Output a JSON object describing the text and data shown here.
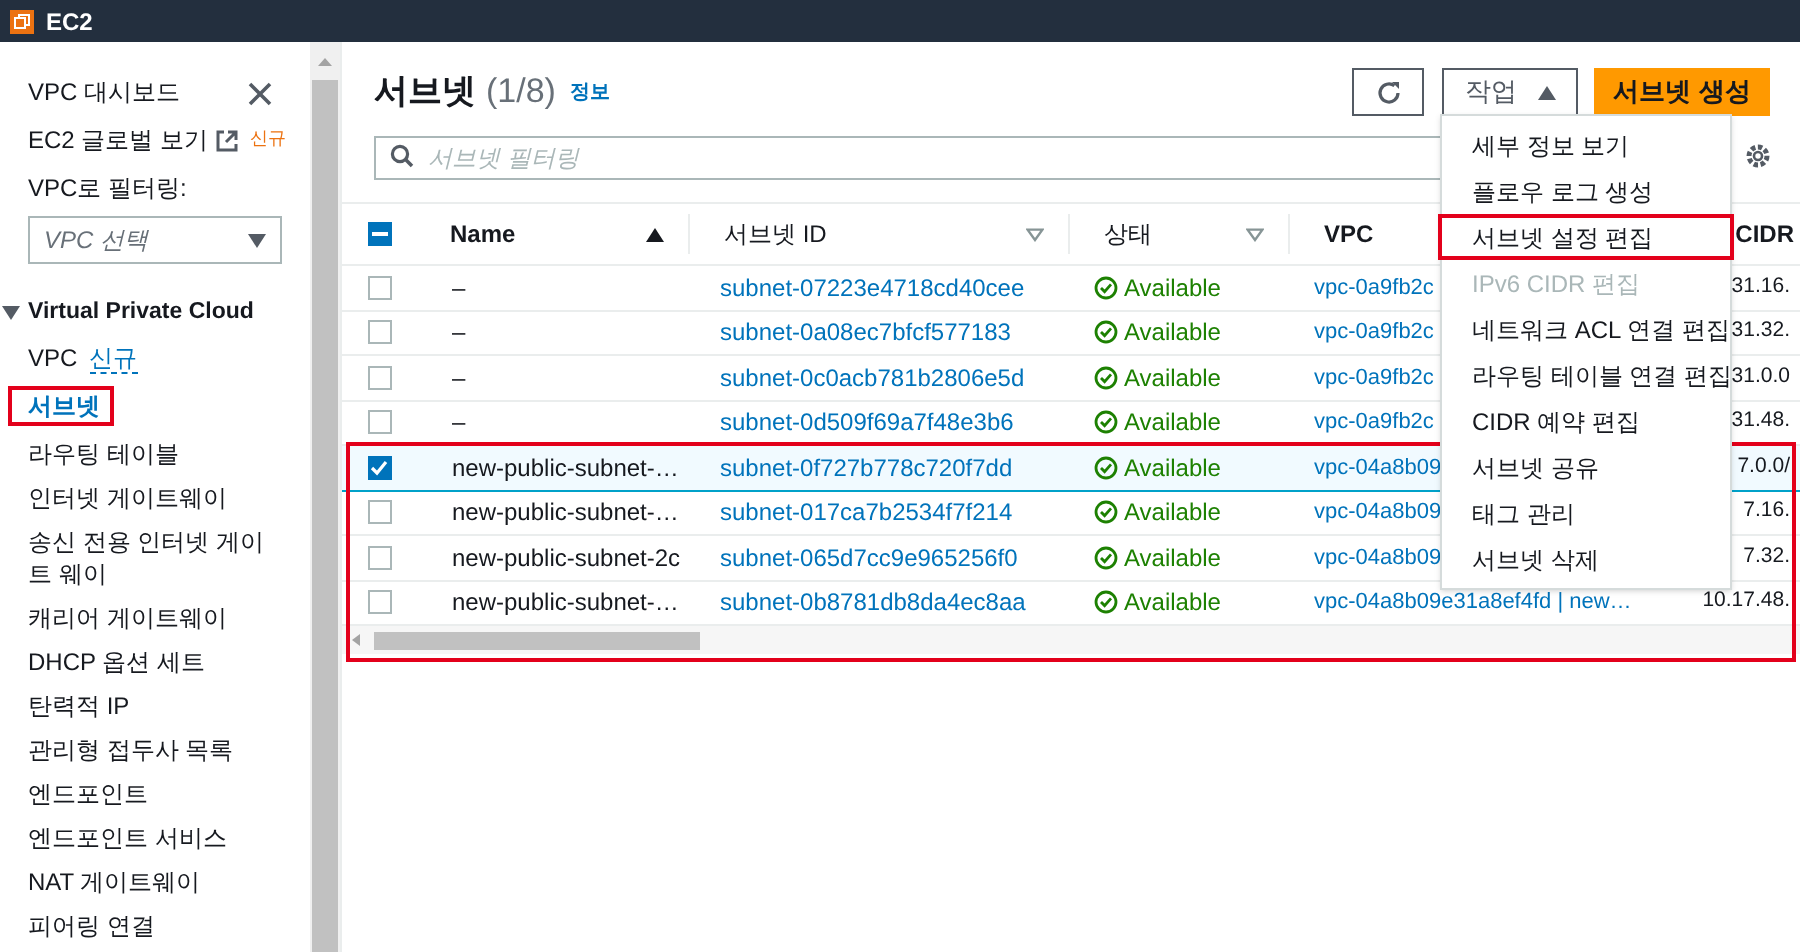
{
  "top_bar": {
    "title": "EC2"
  },
  "sidebar": {
    "links": [
      {
        "label": "VPC 대시보드"
      },
      {
        "label": "EC2 글로벌 보기",
        "badge": "신규"
      }
    ],
    "filter_label": "VPC로 필터링:",
    "vpc_select": {
      "placeholder": "VPC 선택"
    },
    "section": {
      "title": "Virtual Private Cloud",
      "expanded": true,
      "items": [
        {
          "label": "VPC",
          "badge": "신규",
          "selected": false,
          "highlighted": false
        },
        {
          "label": "서브넷",
          "selected": true,
          "highlighted": true
        },
        {
          "label": "라우팅 테이블",
          "selected": false,
          "highlighted": false
        },
        {
          "label": "인터넷 게이트웨이",
          "selected": false,
          "highlighted": false
        },
        {
          "label": "송신 전용 인터넷 게이트 웨이",
          "selected": false,
          "highlighted": false
        },
        {
          "label": "캐리어 게이트웨이",
          "selected": false,
          "highlighted": false
        },
        {
          "label": "DHCP 옵션 세트",
          "selected": false,
          "highlighted": false
        },
        {
          "label": "탄력적 IP",
          "selected": false,
          "highlighted": false
        },
        {
          "label": "관리형 접두사 목록",
          "selected": false,
          "highlighted": false
        },
        {
          "label": "엔드포인트",
          "selected": false,
          "highlighted": false
        },
        {
          "label": "엔드포인트 서비스",
          "selected": false,
          "highlighted": false
        },
        {
          "label": "NAT 게이트웨이",
          "selected": false,
          "highlighted": false
        },
        {
          "label": "피어링 연결",
          "selected": false,
          "highlighted": false
        }
      ]
    }
  },
  "page": {
    "title": "서브넷",
    "count": "(1/8)",
    "info_link": "정보",
    "actions_button": {
      "label": "작업",
      "expanded": true
    },
    "create_button": "서브넷 생성",
    "search": {
      "placeholder": "서브넷 필터링"
    }
  },
  "actions_menu": [
    {
      "label": "세부 정보 보기",
      "disabled": false,
      "highlighted": false
    },
    {
      "label": "플로우 로그 생성",
      "disabled": false,
      "highlighted": false
    },
    {
      "label": "서브넷 설정 편집",
      "disabled": false,
      "highlighted": true
    },
    {
      "label": "IPv6 CIDR 편집",
      "disabled": true,
      "highlighted": false
    },
    {
      "label": "네트워크 ACL 연결 편집",
      "disabled": false,
      "highlighted": false
    },
    {
      "label": "라우팅 테이블 연결 편집",
      "disabled": false,
      "highlighted": false
    },
    {
      "label": "CIDR 예약 편집",
      "disabled": false,
      "highlighted": false
    },
    {
      "label": "서브넷 공유",
      "disabled": false,
      "highlighted": false
    },
    {
      "label": "태그 관리",
      "disabled": false,
      "highlighted": false
    },
    {
      "label": "서브넷 삭제",
      "disabled": false,
      "highlighted": false
    }
  ],
  "table": {
    "header_checkbox": {
      "indeterminate": true
    },
    "columns": [
      {
        "label": "Name",
        "sorted": true
      },
      {
        "label": "서브넷 ID",
        "sorted": false
      },
      {
        "label": "상태",
        "sorted": false
      },
      {
        "label": "VPC"
      },
      {
        "label": "CIDR"
      }
    ],
    "rows": [
      {
        "selected": false,
        "highlighted": false,
        "name": "–",
        "subnet_id": "subnet-07223e4718cd40cee",
        "status": "Available",
        "vpc": "vpc-0a9fb2c",
        "cidr": "31.16."
      },
      {
        "selected": false,
        "highlighted": false,
        "name": "–",
        "subnet_id": "subnet-0a08ec7bfcf577183",
        "status": "Available",
        "vpc": "vpc-0a9fb2c",
        "cidr": "31.32."
      },
      {
        "selected": false,
        "highlighted": false,
        "name": "–",
        "subnet_id": "subnet-0c0acb781b2806e5d",
        "status": "Available",
        "vpc": "vpc-0a9fb2c",
        "cidr": "31.0.0"
      },
      {
        "selected": false,
        "highlighted": false,
        "name": "–",
        "subnet_id": "subnet-0d509f69a7f48e3b6",
        "status": "Available",
        "vpc": "vpc-0a9fb2c",
        "cidr": "31.48."
      },
      {
        "selected": true,
        "highlighted": true,
        "name": "new-public-subnet-…",
        "subnet_id": "subnet-0f727b778c720f7dd",
        "status": "Available",
        "vpc": "vpc-04a8b09",
        "cidr": "7.0.0/"
      },
      {
        "selected": false,
        "highlighted": true,
        "name": "new-public-subnet-…",
        "subnet_id": "subnet-017ca7b2534f7f214",
        "status": "Available",
        "vpc": "vpc-04a8b09",
        "cidr": "7.16."
      },
      {
        "selected": false,
        "highlighted": true,
        "name": "new-public-subnet-2c",
        "subnet_id": "subnet-065d7cc9e965256f0",
        "status": "Available",
        "vpc": "vpc-04a8b09",
        "cidr": "7.32."
      },
      {
        "selected": false,
        "highlighted": true,
        "name": "new-public-subnet-…",
        "subnet_id": "subnet-0b8781db8da4ec8aa",
        "status": "Available",
        "vpc": "vpc-04a8b09e31a8ef4fd | new…",
        "cidr": "10.17.48."
      }
    ]
  }
}
